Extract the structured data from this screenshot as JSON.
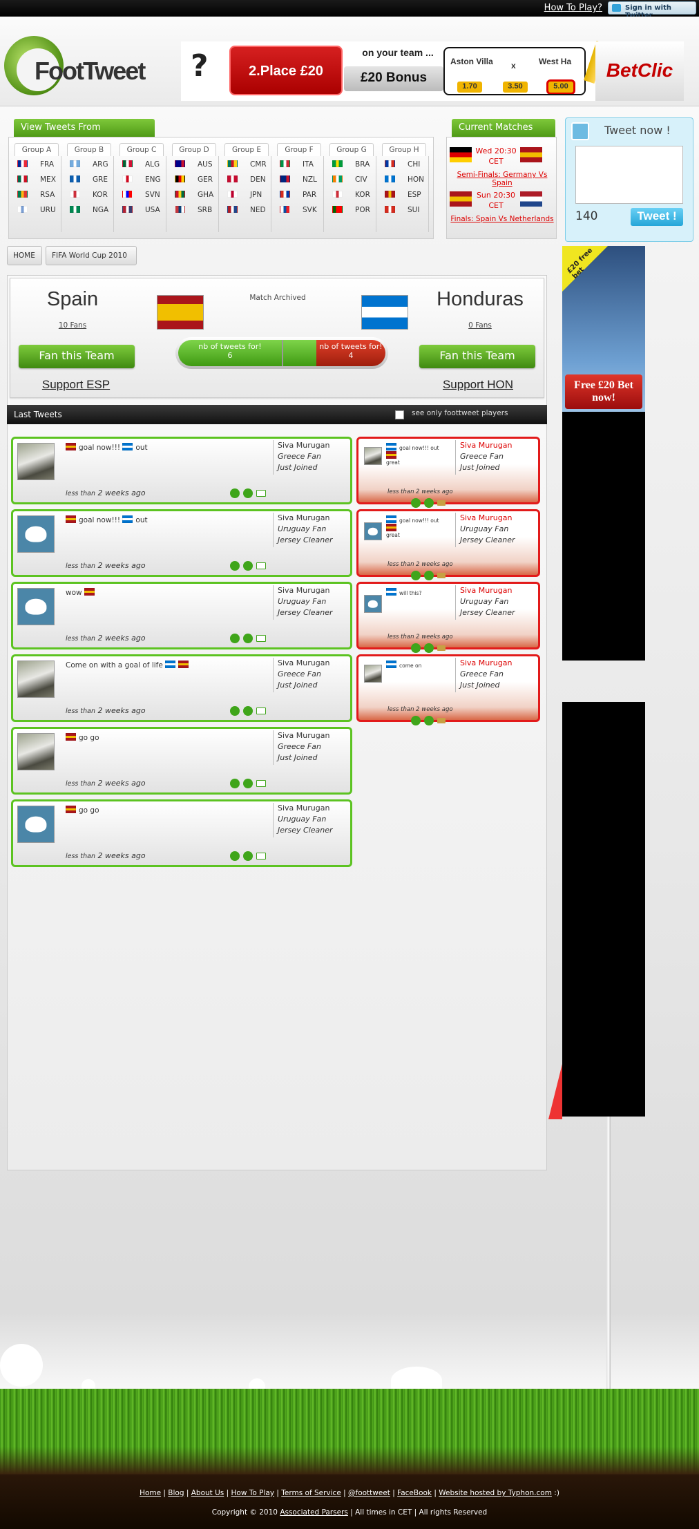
{
  "topbar": {
    "how_to_play": "How To Play?",
    "twitter_signin": "Sign in with Twitter"
  },
  "header": {
    "logo": "FootTweet"
  },
  "banner_ad": {
    "question_mark": "?",
    "place_text": "2.Place £20",
    "on_your_team": "on your team ...",
    "bonus": "£20 Bonus",
    "team1": "Aston Villa",
    "vs": "x",
    "team2": "West Ha",
    "odds": [
      "1.70",
      "3.50",
      "5.00"
    ],
    "brand": "BetClic"
  },
  "groups": {
    "title": "View Tweets From",
    "list": [
      {
        "name": "Group A",
        "teams": [
          {
            "code": "FRA",
            "colors": [
              "#002395",
              "#fff",
              "#ed2939"
            ]
          },
          {
            "code": "MEX",
            "colors": [
              "#006847",
              "#fff",
              "#ce1126"
            ]
          },
          {
            "code": "RSA",
            "colors": [
              "#007a4d",
              "#ffb612",
              "#de3831"
            ]
          },
          {
            "code": "URU",
            "colors": [
              "#fff",
              "#7b9fd3",
              "#fff"
            ]
          }
        ]
      },
      {
        "name": "Group B",
        "teams": [
          {
            "code": "ARG",
            "colors": [
              "#74acdf",
              "#fff",
              "#74acdf"
            ]
          },
          {
            "code": "GRE",
            "colors": [
              "#0d5eaf",
              "#fff",
              "#0d5eaf"
            ]
          },
          {
            "code": "KOR",
            "colors": [
              "#fff",
              "#cd2e3a",
              "#fff"
            ]
          },
          {
            "code": "NGA",
            "colors": [
              "#008751",
              "#fff",
              "#008751"
            ]
          }
        ]
      },
      {
        "name": "Group C",
        "teams": [
          {
            "code": "ALG",
            "colors": [
              "#006233",
              "#fff",
              "#d21034"
            ]
          },
          {
            "code": "ENG",
            "colors": [
              "#fff",
              "#cf081f",
              "#fff"
            ]
          },
          {
            "code": "SVN",
            "colors": [
              "#fff",
              "#0000ff",
              "#ff0000"
            ]
          },
          {
            "code": "USA",
            "colors": [
              "#b22234",
              "#fff",
              "#3c3b6e"
            ]
          }
        ]
      },
      {
        "name": "Group D",
        "teams": [
          {
            "code": "AUS",
            "colors": [
              "#00008b",
              "#00008b",
              "#c8102e"
            ]
          },
          {
            "code": "GER",
            "colors": [
              "#000",
              "#dd0000",
              "#ffce00"
            ]
          },
          {
            "code": "GHA",
            "colors": [
              "#ce1126",
              "#fcd116",
              "#006b3f"
            ]
          },
          {
            "code": "SRB",
            "colors": [
              "#c6363c",
              "#0c4076",
              "#fff"
            ]
          }
        ]
      },
      {
        "name": "Group E",
        "teams": [
          {
            "code": "CMR",
            "colors": [
              "#007a5e",
              "#ce1126",
              "#fcd116"
            ]
          },
          {
            "code": "DEN",
            "colors": [
              "#c60c30",
              "#fff",
              "#c60c30"
            ]
          },
          {
            "code": "JPN",
            "colors": [
              "#fff",
              "#bc002d",
              "#fff"
            ]
          },
          {
            "code": "NED",
            "colors": [
              "#ae1c28",
              "#fff",
              "#21468b"
            ]
          }
        ]
      },
      {
        "name": "Group F",
        "teams": [
          {
            "code": "ITA",
            "colors": [
              "#009246",
              "#fff",
              "#ce2b37"
            ]
          },
          {
            "code": "NZL",
            "colors": [
              "#00247d",
              "#00247d",
              "#cc142b"
            ]
          },
          {
            "code": "PAR",
            "colors": [
              "#d52b1e",
              "#fff",
              "#0038a8"
            ]
          },
          {
            "code": "SVK",
            "colors": [
              "#fff",
              "#0b4ea2",
              "#ee1c25"
            ]
          }
        ]
      },
      {
        "name": "Group G",
        "teams": [
          {
            "code": "BRA",
            "colors": [
              "#009c3b",
              "#ffdf00",
              "#009c3b"
            ]
          },
          {
            "code": "CIV",
            "colors": [
              "#f77f00",
              "#fff",
              "#009e60"
            ]
          },
          {
            "code": "KOR",
            "colors": [
              "#fff",
              "#cd2e3a",
              "#fff"
            ]
          },
          {
            "code": "POR",
            "colors": [
              "#006600",
              "#ff0000",
              "#ff0000"
            ]
          }
        ]
      },
      {
        "name": "Group H",
        "teams": [
          {
            "code": "CHI",
            "colors": [
              "#0039a6",
              "#fff",
              "#d52b1e"
            ]
          },
          {
            "code": "HON",
            "colors": [
              "#0073cf",
              "#fff",
              "#0073cf"
            ]
          },
          {
            "code": "ESP",
            "colors": [
              "#aa151b",
              "#f1bf00",
              "#aa151b"
            ]
          },
          {
            "code": "SUI",
            "colors": [
              "#d52b1e",
              "#fff",
              "#d52b1e"
            ]
          }
        ]
      }
    ]
  },
  "current_matches": {
    "title": "Current Matches",
    "items": [
      {
        "time": "Wed 20:30 CET",
        "link": "Semi-Finals: Germany Vs Spain",
        "flag1": [
          "#000",
          "#dd0000",
          "#ffce00"
        ],
        "flag2": [
          "#aa151b",
          "#f1bf00",
          "#aa151b"
        ]
      },
      {
        "time": "Sun 20:30 CET",
        "link": "Finals: Spain Vs Netherlands",
        "flag1": [
          "#aa151b",
          "#f1bf00",
          "#aa151b"
        ],
        "flag2": [
          "#ae1c28",
          "#fff",
          "#21468b"
        ]
      }
    ]
  },
  "tweet_now": {
    "title": "Tweet now !",
    "counter": "140",
    "button": "Tweet !"
  },
  "breadcrumb": {
    "home": "HOME",
    "section": "FIFA World Cup 2010"
  },
  "match": {
    "status": "Match Archived",
    "team1": {
      "name": "Spain",
      "fans": "10 Fans",
      "fan_button": "Fan this Team",
      "support": "Support ESP"
    },
    "team2": {
      "name": "Honduras",
      "fans": "0 Fans",
      "fan_button": "Fan this Team",
      "support": "Support HON"
    },
    "tweets_label": "nb of tweets for!",
    "tweets1": "6",
    "tweets2": "4"
  },
  "last_tweets": {
    "title": "Last Tweets",
    "filter_label": "see only foottweet players",
    "left": [
      {
        "pre": "",
        "text": "goal now!!!",
        "post": "out",
        "time_a": "less than",
        "time_b": "2 weeks ago",
        "user": "Siva Murugan",
        "fan": "Greece Fan",
        "status": "Just Joined",
        "avatar": "photo"
      },
      {
        "pre": "",
        "text": "goal now!!!",
        "post": "out",
        "time_a": "less than",
        "time_b": "2 weeks ago",
        "user": "Siva Murugan",
        "fan": "Uruguay Fan",
        "status": "Jersey Cleaner",
        "avatar": "bird"
      },
      {
        "pre": "wow",
        "text": "",
        "post": "",
        "time_a": "less than",
        "time_b": "2 weeks ago",
        "user": "Siva Murugan",
        "fan": "Uruguay Fan",
        "status": "Jersey Cleaner",
        "avatar": "bird"
      },
      {
        "pre": "Come on with a goal of life",
        "text": "",
        "post": "",
        "time_a": "less than",
        "time_b": "2 weeks ago",
        "user": "Siva Murugan",
        "fan": "Greece Fan",
        "status": "Just Joined",
        "avatar": "photo"
      },
      {
        "pre": "",
        "text": "go go",
        "post": "",
        "time_a": "less than",
        "time_b": "2 weeks ago",
        "user": "Siva Murugan",
        "fan": "Greece Fan",
        "status": "Just Joined",
        "avatar": "photo"
      },
      {
        "pre": "",
        "text": "go go",
        "post": "",
        "time_a": "less than",
        "time_b": "2 weeks ago",
        "user": "Siva Murugan",
        "fan": "Uruguay Fan",
        "status": "Jersey Cleaner",
        "avatar": "bird"
      }
    ],
    "right": [
      {
        "text": "goal now!!! out",
        "extra": "great",
        "time": "less than 2 weeks ago",
        "user": "Siva Murugan",
        "fan": "Greece Fan",
        "status": "Just Joined",
        "avatar": "photo"
      },
      {
        "text": "goal now!!! out",
        "extra": "great",
        "time": "less than 2 weeks ago",
        "user": "Siva Murugan",
        "fan": "Uruguay Fan",
        "status": "Jersey Cleaner",
        "avatar": "bird"
      },
      {
        "text": "will this?",
        "extra": "",
        "time": "less than 2 weeks ago",
        "user": "Siva Murugan",
        "fan": "Uruguay Fan",
        "status": "Jersey Cleaner",
        "avatar": "bird"
      },
      {
        "text": "come on",
        "extra": "",
        "time": "less than 2 weeks ago",
        "user": "Siva Murugan",
        "fan": "Greece Fan",
        "status": "Just Joined",
        "avatar": "photo"
      }
    ]
  },
  "side_ad": {
    "corner": "£20 free bet",
    "button": "Free £20 Bet now!"
  },
  "footer": {
    "links": [
      "Home",
      "Blog",
      "About Us",
      "How To Play",
      "Terms of Service",
      "@foottweet",
      "FaceBook",
      "Website hosted by Typhon.com"
    ],
    "tail": ":)",
    "copyright_pre": "Copyright © 2010",
    "company": "Associated Parsers",
    "copyright_post": "| All times in CET | All rights Reserved"
  },
  "colors": {
    "green": "#5cc321",
    "red": "#e21a1a",
    "accent_blue": "#24a6d8"
  }
}
